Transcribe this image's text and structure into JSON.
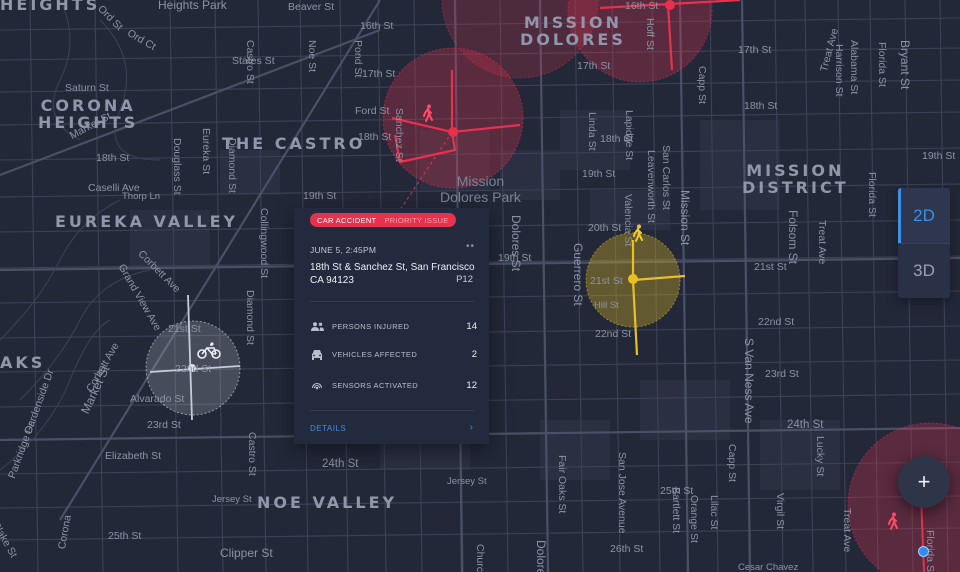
{
  "map": {
    "neighborhoods": [
      "HEIGHTS",
      "CORONA\nHEIGHTS",
      "THE CASTRO",
      "EUREKA VALLEY",
      "MISSION\nDOLORES",
      "MISSION\nDISTRICT",
      "NOE VALLEY",
      "AKS"
    ],
    "park": "Mission\nDolores Park",
    "streets": {
      "heights_park": "Heights Park",
      "beaver_st": "Beaver St",
      "st16_a": "16th St",
      "st16_b": "16th St",
      "st17_a": "17th St",
      "st17_b": "17th St",
      "st17_c": "17th St",
      "st18_a": "18th St",
      "st18_b": "18th St",
      "st18_c": "18th St",
      "st19_a": "19th St",
      "st19_b": "19th St",
      "st19_c": "19th St",
      "st20_a": "20th St",
      "st20_b": "20th St",
      "st21_a": "21st St",
      "st21_b": "21st St",
      "st21_c": "21st St",
      "st22_a": "22nd St",
      "st22_b": "22nd St",
      "st22_c": "22nd St",
      "st23_a": "23rd St",
      "st23_b": "23rd St",
      "st24_a": "24th St",
      "st24_b": "24th St",
      "st25_a": "25th St",
      "st25_b": "25th St",
      "st26": "26th St",
      "ord_st": "Ord St",
      "ord_ct": "Ord Ct",
      "states_st": "States St",
      "saturn_st": "Saturn St",
      "market_st_a": "Market St",
      "market_st_b": "Market St",
      "ford_st": "Ford St",
      "caselli": "Caselli Ave",
      "thorp": "Thorp Ln",
      "castro_st": "Castro St",
      "noe_st": "Noe St",
      "pond_st": "Pond St",
      "sanchez_st": "Sanchez St",
      "church_st": "Church St",
      "dolores_st": "Dolores St",
      "guerrero_st": "Guerrero St",
      "valencia_st": "Valencia St",
      "linda_st": "Linda St",
      "lapidge_st": "Lapidge St",
      "leavenworth_st": "Leavenworth St",
      "san_carlos_st": "San Carlos St",
      "mission_st": "Mission St",
      "hoff_st": "Hoff St",
      "capp_st_a": "Capp St",
      "capp_st_b": "Capp St",
      "folsom_st": "Folsom St",
      "treat_ave_a": "Treat Ave",
      "treat_ave_b": "Treat Ave",
      "alabama_st": "Alabama St",
      "harrison_st": "Harrison St",
      "bryant_st": "Bryant St",
      "florida_st_a": "Florida St",
      "florida_st_b": "Florida St",
      "eureka_st": "Eureka St",
      "douglass_st": "Douglass St",
      "diamond_st_a": "Diamond St",
      "diamond_st_b": "Diamond St",
      "collingwood_st": "Collingwood St",
      "corbett_ave": "Corbett Ave",
      "grand_view_ave": "Grand View Ave",
      "alvarado_st": "Alvarado St",
      "elizabeth_st": "Elizabeth St",
      "jersey_st_a": "Jersey St",
      "jersey_st_b": "Jersey St",
      "clipper_st": "Clipper St",
      "gardenside": "Gardenside Dr",
      "parkridge": "Parkridge Dr",
      "burnett": "Burnett Ave",
      "crown_terrace": "Crown Terrace",
      "hill_st": "Hill St",
      "s_van_ness": "S Van Ness Ave",
      "fair_oaks": "Fair Oaks St",
      "san_jose_ave": "San Jose Avenue",
      "bartlett_st": "Bartlett St",
      "orange_st": "Orange St",
      "lilac_st": "Lilac St",
      "lucky_st": "Lucky St",
      "virgil_st": "Virgil St",
      "cesar_chavez": "Cesar Chavez",
      "blake_st": "Blake St",
      "corona": "Corona",
      "dolores_bottom": "Dolore",
      "church_bottom": "Church"
    }
  },
  "incident_card": {
    "tag_type": "CAR ACCIDENT",
    "tag_priority": "PRIORITY ISSUE",
    "date": "JUNE 5, 2:45PM",
    "more": "••",
    "address": "18th St & Sanchez St, San Francisco CA 94123",
    "code": "P12",
    "stats": [
      {
        "label": "PERSONS INJURED",
        "value": "14",
        "icon": "persons-icon"
      },
      {
        "label": "VEHICLES AFFECTED",
        "value": "2",
        "icon": "car-icon"
      },
      {
        "label": "SENSORS ACTIVATED",
        "value": "12",
        "icon": "sensor-icon"
      }
    ],
    "details_label": "DETAILS",
    "details_chevron": "›"
  },
  "view_toggle": {
    "option_2d": "2D",
    "option_3d": "3D",
    "active": "2D"
  },
  "fab_label": "+",
  "colors": {
    "background": "#232839",
    "critical": "#e8314d",
    "warning": "#d9b520",
    "neutral": "#c8ccd6",
    "accent": "#3d8fe8"
  },
  "icons": [
    "pedestrian-icon",
    "pedestrian-icon",
    "bicycle-icon",
    "pedestrian-icon",
    "persons-icon",
    "car-icon",
    "sensor-icon",
    "plus-icon"
  ]
}
